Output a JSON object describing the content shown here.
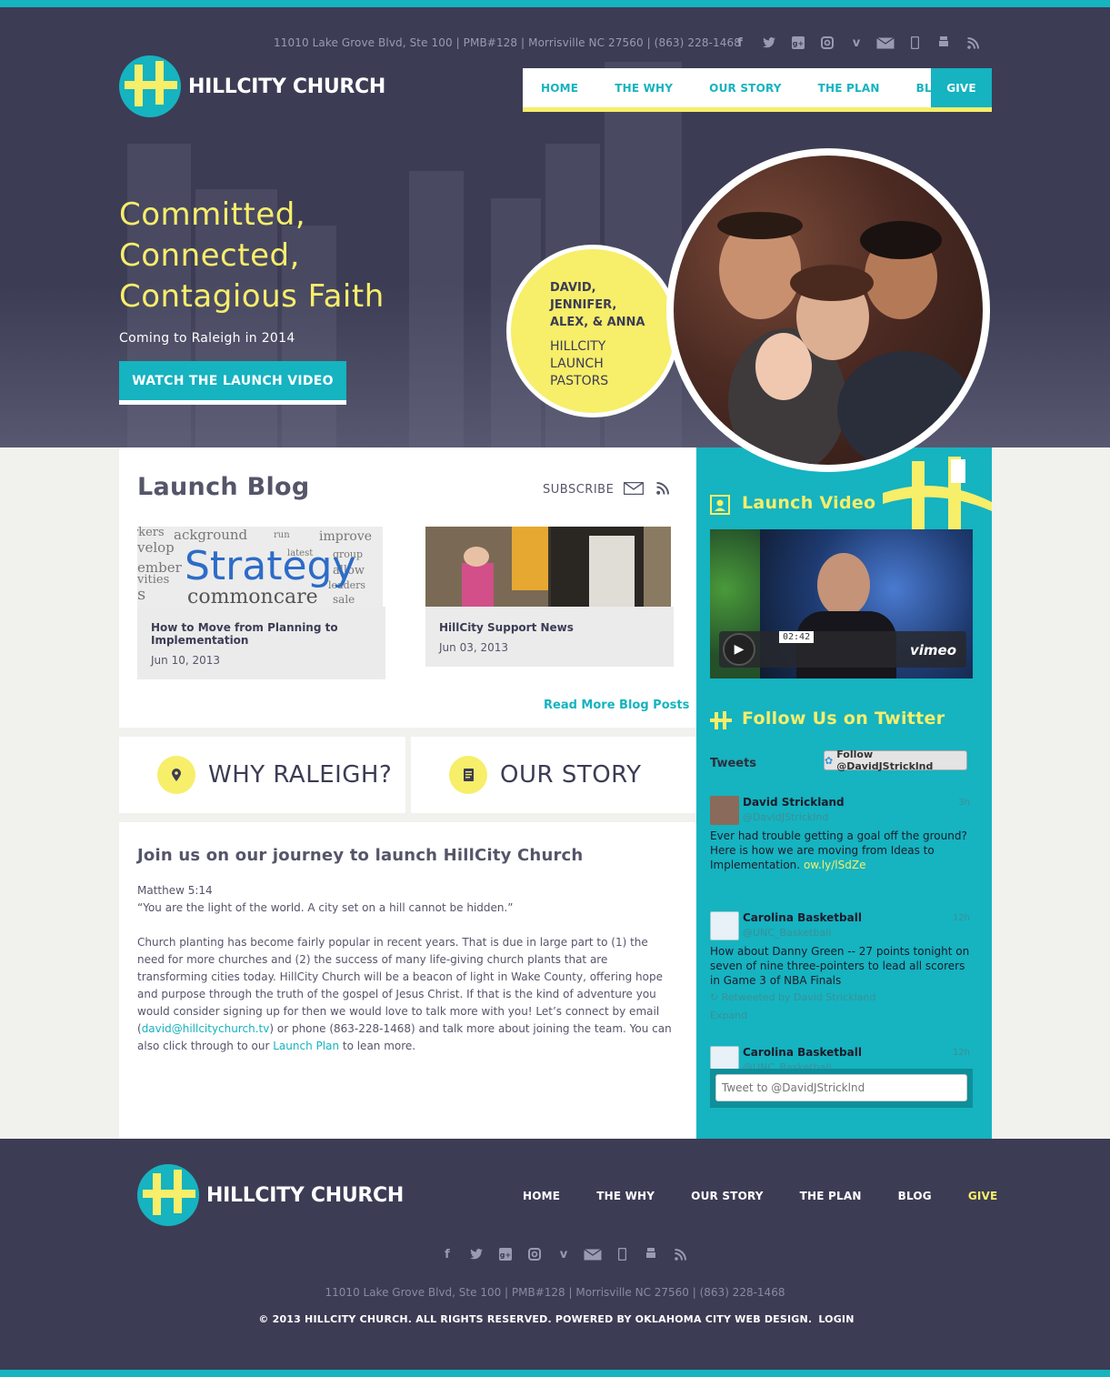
{
  "header": {
    "address": "11010 Lake Grove Blvd, Ste 100 | PMB#128 | Morrisville NC 27560 | (863) 228-1468",
    "social_icons": [
      "facebook-icon",
      "twitter-icon",
      "google-plus-icon",
      "instagram-icon",
      "vimeo-icon",
      "email-icon",
      "mobile-icon",
      "android-icon",
      "rss-icon"
    ],
    "logo_text": "HILLCITY CHURCH"
  },
  "nav": {
    "items": [
      "HOME",
      "THE WHY",
      "OUR STORY",
      "THE PLAN",
      "BLOG"
    ],
    "give": "GIVE"
  },
  "hero": {
    "headline": [
      "Committed,",
      "Connected,",
      "Contagious Faith"
    ],
    "subhead": "Coming to Raleigh in 2014",
    "cta": "WATCH THE LAUNCH VIDEO",
    "pastor_names": [
      "DAVID,",
      "JENNIFER,",
      "ALEX, & ANNA"
    ],
    "pastor_role": [
      "HILLCITY",
      "LAUNCH",
      "PASTORS"
    ]
  },
  "blog": {
    "title": "Launch Blog",
    "subscribe": "SUBSCRIBE",
    "posts": [
      {
        "title": "How to Move from Planning to Implementation",
        "date": "Jun 10, 2013"
      },
      {
        "title": "HillCity Support News",
        "date": "Jun 03, 2013"
      }
    ],
    "read_more": "Read More Blog Posts"
  },
  "tiles": {
    "why_raleigh": "WHY RALEIGH?",
    "our_story": "OUR STORY"
  },
  "content": {
    "title": "Join us on our journey to launch HillCity Church",
    "scripture_ref": "Matthew 5:14",
    "scripture_text": "“You are the light of the world. A city set on a hill cannot be hidden.”",
    "body_1": "Church planting has become fairly popular in recent years.  That is due in large part to (1) the need for more churches and (2) the success of many life-giving church plants that are transforming cities today.  HillCity Church will be a beacon of light in Wake County, offering hope and purpose through the truth of the gospel of Jesus Christ.  If that is the kind of adventure you would consider signing up for then we would love to talk more with you!  Let’s connect by email (",
    "email": "david@hillcitychurch.tv",
    "body_2": ") or phone (863-228-1468) and talk more about joining the team.  You can also click through to our ",
    "launch_plan_link": "Launch Plan",
    "body_3": " to lean more."
  },
  "sidebar": {
    "video_heading": "Launch Video",
    "video_time": "02:42",
    "video_brand": "vimeo",
    "twitter_heading": "Follow Us on Twitter",
    "tweets_label": "Tweets",
    "follow_button": "Follow @DavidJStricklnd",
    "tweets": [
      {
        "name": "David Strickland",
        "handle": "@DavidJStricklnd",
        "time": "3h",
        "text": "Ever had trouble getting a goal off the ground?  Here is how we are moving from Ideas to Implementation.",
        "link": "ow.ly/lSdZe"
      },
      {
        "name": "Carolina Basketball",
        "handle": "@UNC_Basketball",
        "time": "12h",
        "text": "How about Danny Green -- 27 points tonight on seven of nine three-pointers to lead all scorers in Game 3 of NBA Finals",
        "retweet": "Retweeted by David Strickland",
        "expand": "Expand"
      },
      {
        "name": "Carolina Basketball",
        "handle": "@UNC_Basketball",
        "time": "12h"
      }
    ],
    "tweet_placeholder": "Tweet to @DavidJStricklnd"
  },
  "footer": {
    "logo_text": "HILLCITY CHURCH",
    "nav": [
      "HOME",
      "THE WHY",
      "OUR STORY",
      "THE PLAN",
      "BLOG"
    ],
    "give": "GIVE",
    "address": "11010 Lake Grove Blvd, Ste 100 | PMB#128 | Morrisville NC 27560 | (863) 228-1468",
    "copyright": "© 2013 HILLCITY CHURCH. ALL RIGHTS RESERVED. POWERED BY OKLAHOMA CITY WEB DESIGN.",
    "login": "LOGIN"
  },
  "colors": {
    "teal": "#16b3c0",
    "yellow": "#f7ee6a",
    "navy": "#3c3c55"
  }
}
